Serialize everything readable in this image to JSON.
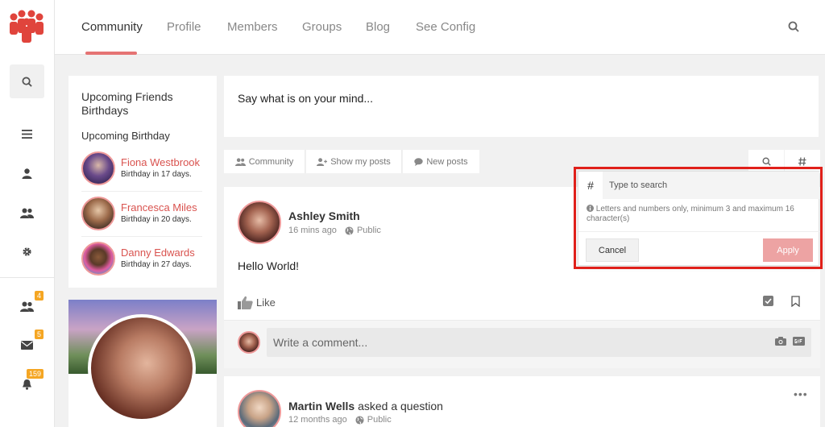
{
  "nav": {
    "items": [
      "Community",
      "Profile",
      "Members",
      "Groups",
      "Blog",
      "See Config"
    ]
  },
  "rail": {
    "badges": {
      "friends": "4",
      "messages": "5",
      "notifications": "159"
    }
  },
  "birthdays": {
    "title": "Upcoming Friends Birthdays",
    "subtitle": "Upcoming Birthday",
    "people": [
      {
        "name": "Fiona Westbrook",
        "when": "Birthday in 17 days."
      },
      {
        "name": "Francesca Miles",
        "when": "Birthday in 20 days."
      },
      {
        "name": "Danny Edwards",
        "when": "Birthday in 27 days."
      }
    ]
  },
  "composer": {
    "placeholder": "Say what is on your mind..."
  },
  "filters": {
    "community": "Community",
    "mine": "Show my posts",
    "new": "New posts"
  },
  "post1": {
    "author": "Ashley Smith",
    "time": "16 mins ago",
    "visibility": "Public",
    "body": "Hello World!",
    "like": "Like",
    "comment_placeholder": "Write a comment..."
  },
  "post2": {
    "author": "Martin Wells",
    "action": "asked a question",
    "time": "12 months ago",
    "visibility": "Public"
  },
  "hashtag_popup": {
    "symbol": "#",
    "placeholder": "Type to search",
    "info": "Letters and numbers only, minimum 3 and maximum 16 character(s)",
    "cancel": "Cancel",
    "apply": "Apply"
  },
  "colors": {
    "accent": "#e57373",
    "link": "#d9534f",
    "apply": "#eda3a3",
    "highlight": "#e0201a"
  }
}
